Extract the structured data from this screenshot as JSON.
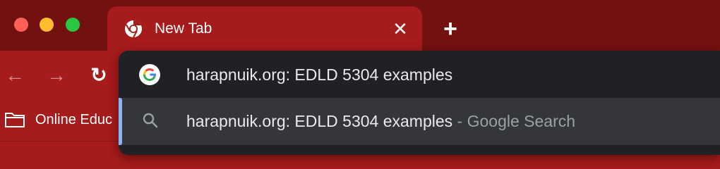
{
  "window": {
    "tab": {
      "title": "New Tab",
      "close_glyph": "✕"
    },
    "new_tab_glyph": "+"
  },
  "toolbar": {
    "back_glyph": "←",
    "forward_glyph": "→",
    "reload_glyph": "↻"
  },
  "bookmarks": {
    "items": [
      {
        "label": "Online Educ",
        "icon": "folder-icon"
      }
    ]
  },
  "omnibox": {
    "suggestions": [
      {
        "icon": "google-icon",
        "text": "harapnuik.org: EDLD 5304 examples",
        "suffix": ""
      },
      {
        "icon": "search-icon",
        "text": "harapnuik.org: EDLD 5304 examples",
        "suffix": " - Google Search",
        "selected": true
      }
    ]
  },
  "colors": {
    "frame": "#731010",
    "toolbar": "#a61b1b",
    "dropdown_bg": "#202124",
    "dropdown_selected": "#35363a",
    "accent": "#8ab4f8"
  }
}
